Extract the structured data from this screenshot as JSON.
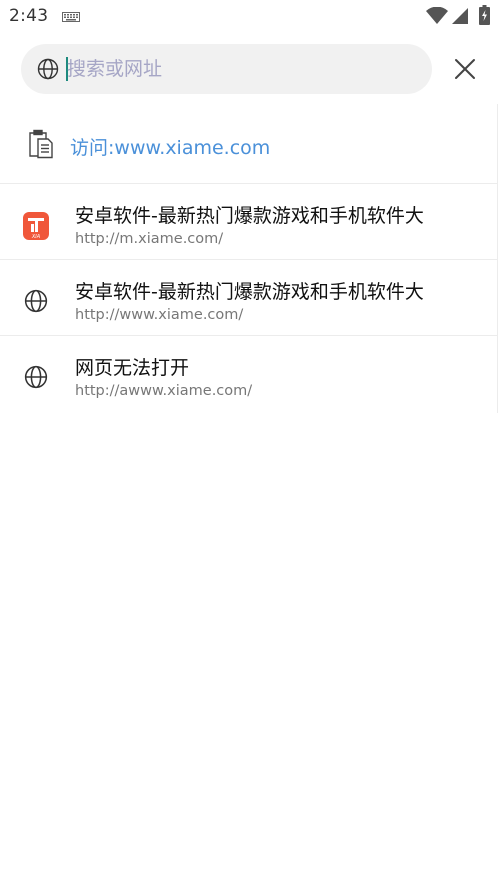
{
  "status_bar": {
    "time": "2:43"
  },
  "search": {
    "placeholder": "搜索或网址",
    "value": ""
  },
  "suggestions": {
    "visit": {
      "label": "访问:www.xiame.com"
    },
    "items": [
      {
        "title": "安卓软件-最新热门爆款游戏和手机软件大",
        "url": "http://m.xiame.com/",
        "icon": "xiame-app-logo",
        "logo_text": "XIA"
      },
      {
        "title": "安卓软件-最新热门爆款游戏和手机软件大",
        "url": "http://www.xiame.com/",
        "icon": "globe-icon"
      },
      {
        "title": "网页无法打开",
        "url": "http://awww.xiame.com/",
        "icon": "globe-icon"
      }
    ]
  },
  "colors": {
    "accent_link": "#4a90d9",
    "caret": "#1d8a7e",
    "logo_bg": "#f0573a",
    "search_bg": "#f1f1f1"
  }
}
